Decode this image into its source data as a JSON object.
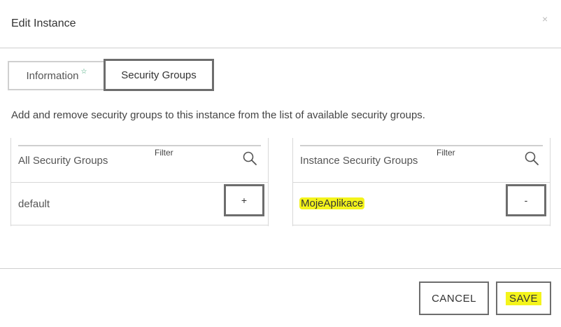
{
  "dialog": {
    "title": "Edit Instance",
    "close_glyph": "×"
  },
  "tabs": [
    {
      "label": "Information",
      "badge": "☆"
    },
    {
      "label": "Security Groups"
    }
  ],
  "description": "Add and remove security groups to this instance from the list of available security groups.",
  "all_groups": {
    "header": "All Security Groups",
    "filter_label": "Filter",
    "items": [
      {
        "name": "default",
        "action": "+"
      }
    ]
  },
  "instance_groups": {
    "header": "Instance Security Groups",
    "filter_label": "Filter",
    "items": [
      {
        "name": "MojeAplikace",
        "action": "-"
      }
    ]
  },
  "footer": {
    "cancel_label": "CANCEL",
    "save_label": "SAVE"
  },
  "colors": {
    "highlight": "#f4f41b",
    "focus_border": "#6d6d6d",
    "star": "#2e9e6b"
  },
  "icons": {
    "search": "search-icon",
    "close": "close-icon",
    "star": "star-icon"
  }
}
